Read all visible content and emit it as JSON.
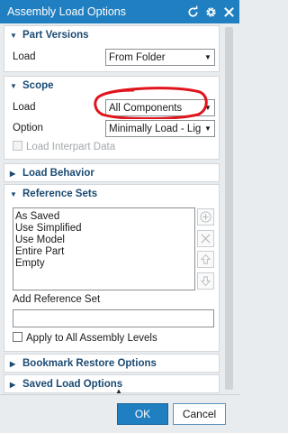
{
  "window": {
    "title": "Assembly Load Options"
  },
  "part_versions": {
    "header": "Part Versions",
    "load_label": "Load",
    "load_value": "From Folder"
  },
  "scope": {
    "header": "Scope",
    "load_label": "Load",
    "load_value": "All Components",
    "option_label": "Option",
    "option_value": "Minimally Load - Lig",
    "interpart_label": "Load Interpart Data"
  },
  "load_behavior": {
    "header": "Load Behavior"
  },
  "reference_sets": {
    "header": "Reference Sets",
    "items": [
      "As Saved",
      "Use Simplified",
      "Use Model",
      "Entire Part",
      "Empty"
    ],
    "add_label": "Add Reference Set",
    "add_value": "",
    "apply_label": "Apply to All Assembly Levels"
  },
  "bookmark_restore": {
    "header": "Bookmark Restore Options"
  },
  "saved_load": {
    "header": "Saved Load Options"
  },
  "buttons": {
    "ok": "OK",
    "cancel": "Cancel"
  },
  "colors": {
    "titlebar": "#1f7fc0",
    "section_text": "#1b4b74",
    "annotation": "#e0141c"
  }
}
